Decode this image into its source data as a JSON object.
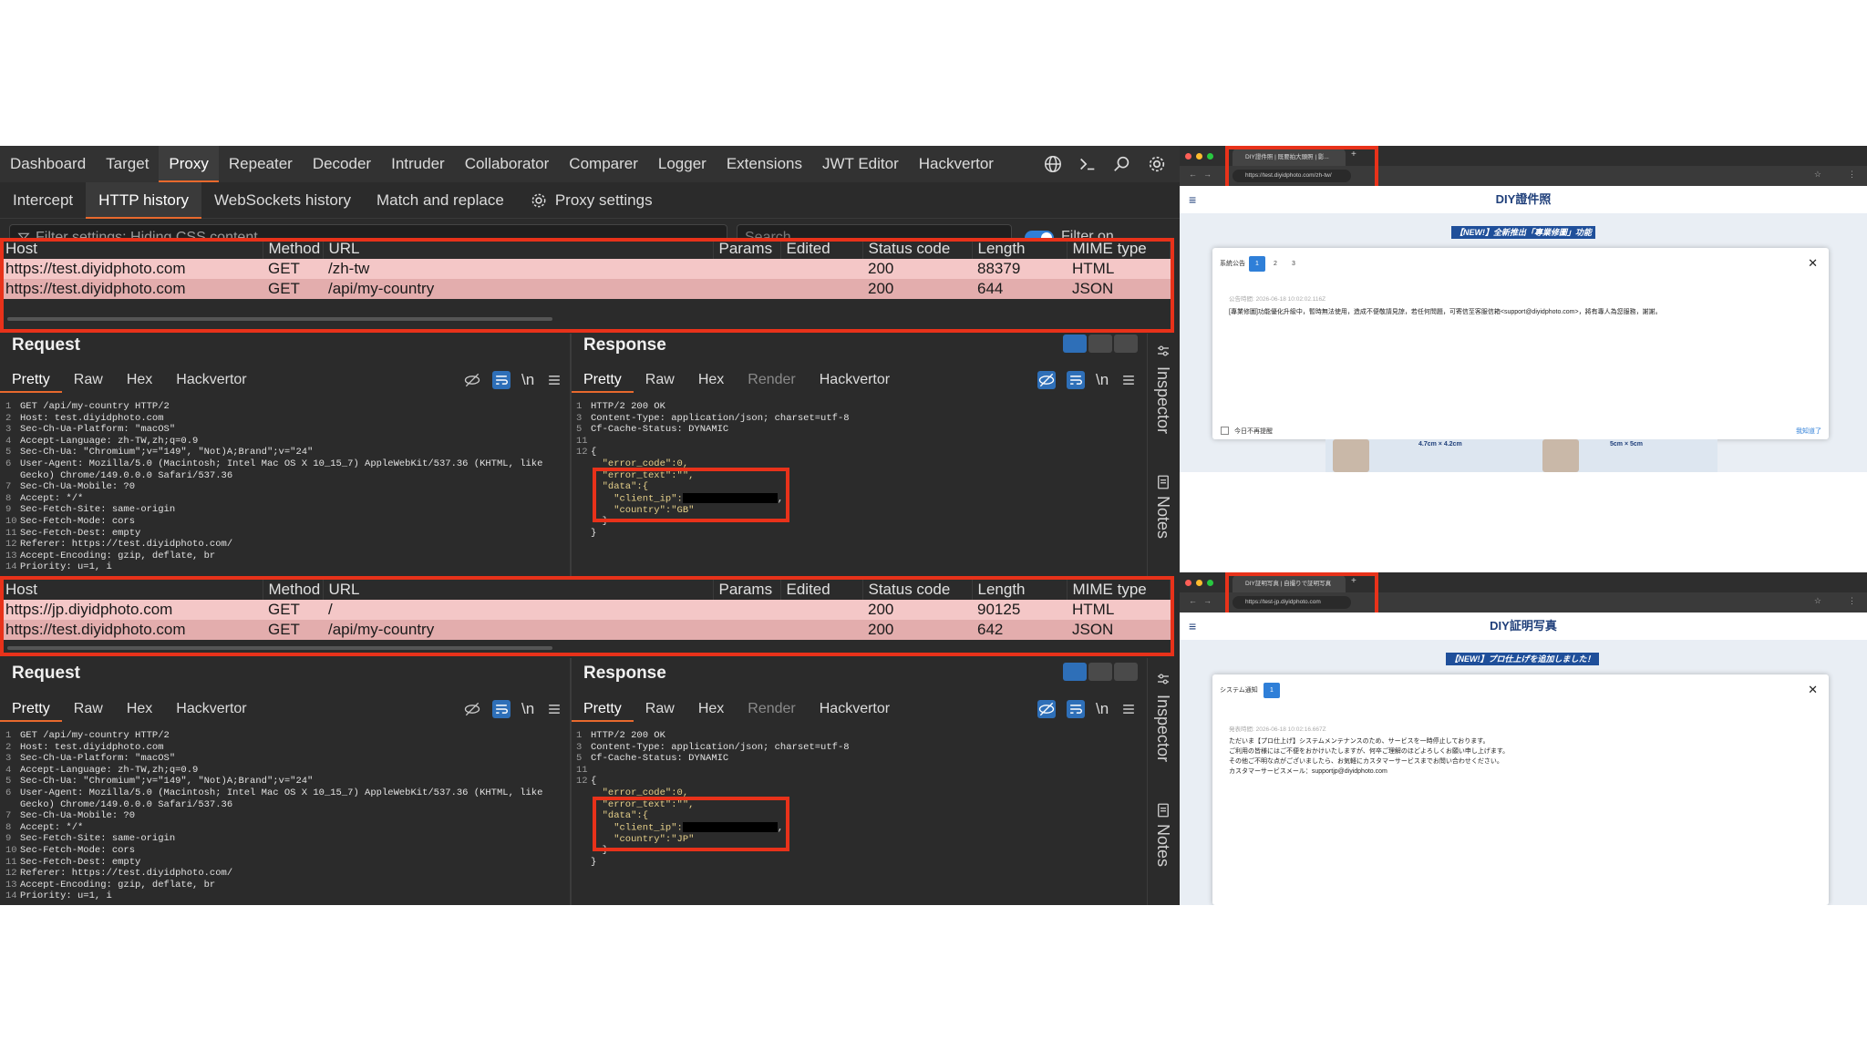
{
  "burp": {
    "tabs": [
      "Dashboard",
      "Target",
      "Proxy",
      "Repeater",
      "Decoder",
      "Intruder",
      "Collaborator",
      "Comparer",
      "Logger",
      "Extensions",
      "JWT Editor",
      "Hackvertor"
    ],
    "subtabs": [
      "Intercept",
      "HTTP history",
      "WebSockets history",
      "Match and replace",
      "Proxy settings"
    ],
    "filter_text": "Filter settings: Hiding CSS content",
    "search_placeholder": "Search",
    "filter_on_label": "Filter on",
    "table_headers": [
      "Host",
      "Method",
      "URL",
      "Params",
      "Edited",
      "Status code",
      "Length",
      "MIME type"
    ],
    "history1": [
      {
        "host": "https://test.diyidphoto.com",
        "method": "GET",
        "url": "/zh-tw",
        "status": "200",
        "length": "88379",
        "mime": "HTML"
      },
      {
        "host": "https://test.diyidphoto.com",
        "method": "GET",
        "url": "/api/my-country",
        "status": "200",
        "length": "644",
        "mime": "JSON"
      }
    ],
    "history2": [
      {
        "host": "https://jp.diyidphoto.com",
        "method": "GET",
        "url": "/",
        "status": "200",
        "length": "90125",
        "mime": "HTML"
      },
      {
        "host": "https://test.diyidphoto.com",
        "method": "GET",
        "url": "/api/my-country",
        "status": "200",
        "length": "642",
        "mime": "JSON"
      }
    ],
    "request_title": "Request",
    "response_title": "Response",
    "request_tabs": [
      "Pretty",
      "Raw",
      "Hex",
      "Hackvertor"
    ],
    "response_tabs": [
      "Pretty",
      "Raw",
      "Hex",
      "Render",
      "Hackvertor"
    ],
    "newline_label": "\\n",
    "inspector_label": "Inspector",
    "notes_label": "Notes",
    "request_lines": [
      [
        "1",
        "GET /api/my-country HTTP/2"
      ],
      [
        "2",
        "Host: test.diyidphoto.com"
      ],
      [
        "3",
        "Sec-Ch-Ua-Platform: \"macOS\""
      ],
      [
        "4",
        "Accept-Language: zh-TW,zh;q=0.9"
      ],
      [
        "5",
        "Sec-Ch-Ua: \"Chromium\";v=\"149\", \"Not)A;Brand\";v=\"24\""
      ],
      [
        "6",
        "User-Agent: Mozilla/5.0 (Macintosh; Intel Mac OS X 10_15_7) AppleWebKit/537.36 (KHTML, like"
      ],
      [
        "",
        "Gecko) Chrome/149.0.0.0 Safari/537.36"
      ],
      [
        "7",
        "Sec-Ch-Ua-Mobile: ?0"
      ],
      [
        "8",
        "Accept: */*"
      ],
      [
        "9",
        "Sec-Fetch-Site: same-origin"
      ],
      [
        "10",
        "Sec-Fetch-Mode: cors"
      ],
      [
        "11",
        "Sec-Fetch-Dest: empty"
      ],
      [
        "12",
        "Referer: https://test.diyidphoto.com/"
      ],
      [
        "13",
        "Accept-Encoding: gzip, deflate, br"
      ],
      [
        "14",
        "Priority: u=1, i"
      ]
    ],
    "response1_lines": [
      [
        "1",
        "HTTP/2 200 OK"
      ],
      [
        "3",
        "Content-Type: application/json; charset=utf-8"
      ],
      [
        "5",
        "Cf-Cache-Status: DYNAMIC"
      ],
      [
        "11",
        ""
      ],
      [
        "12",
        "{"
      ],
      [
        "",
        "  \"error_code\":0,"
      ],
      [
        "",
        "  \"error_text\":\"\","
      ],
      [
        "",
        "  \"data\":{"
      ],
      [
        "",
        "    \"client_ip\":"
      ],
      [
        "",
        "    \"country\":\"GB\""
      ],
      [
        "",
        "  }"
      ],
      [
        "",
        "}"
      ]
    ],
    "response2_lines": [
      [
        "1",
        "HTTP/2 200 OK"
      ],
      [
        "3",
        "Content-Type: application/json; charset=utf-8"
      ],
      [
        "5",
        "Cf-Cache-Status: DYNAMIC"
      ],
      [
        "11",
        ""
      ],
      [
        "12",
        "{"
      ],
      [
        "",
        "  \"error_code\":0,"
      ],
      [
        "",
        "  \"error_text\":\"\","
      ],
      [
        "",
        "  \"data\":{"
      ],
      [
        "",
        "    \"client_ip\":"
      ],
      [
        "",
        "    \"country\":\"JP\""
      ],
      [
        "",
        "  }"
      ],
      [
        "",
        "}"
      ]
    ]
  },
  "browser1": {
    "tab_title": "DIY證件照 | 既要拍大頭照 | 影...",
    "url": "https://test.diyidphoto.com/zh-tw/",
    "page_title": "DIY證件照",
    "banner": "【NEW!】全新推出「專業修圖」功能",
    "modal_title": "系統公告",
    "pages": [
      "1",
      "2",
      "3"
    ],
    "time": "公告時間: 2026-06-18 10:02:02.116Z",
    "body": "[專業修圖]功能優化升級中，暫時無法使用，造成不便敬請見諒，若任何問題，可寄信至客服信箱<support@diyidphoto.com>，將有專人為您服務，謝謝。",
    "checkbox_label": "今日不再提醒",
    "got_it": "我知道了",
    "card1_size": "4.7cm × 4.2cm",
    "card2_size": "5cm × 5cm"
  },
  "browser2": {
    "tab_title": "DIY証明写真 | 自撮りで証明写真",
    "url": "https://test-jp.diyidphoto.com",
    "page_title": "DIY証明写真",
    "banner": "【NEW!】プロ仕上げを追加しました！",
    "modal_title": "システム通知",
    "pages": [
      "1"
    ],
    "time": "発表時間: 2026-06-18 10:02:16.667Z",
    "body_lines": [
      "ただいま【プロ仕上げ】システムメンテナンスのため、サービスを一時停止しております。",
      "ご利用の皆様にはご不便をおかけいたしますが、何卒ご理解のほどよろしくお願い申し上げます。",
      "その他ご不明な点がございましたら、お気軽にカスタマーサービスまでお問い合わせください。",
      "カスタマーサービスメール：supportjp@diyidphoto.com"
    ]
  },
  "colors": {
    "accent": "#e8692d",
    "highlight_box": "#e8321a",
    "row_pink": "#f4c7c7",
    "brand_blue": "#1f4f9a"
  }
}
